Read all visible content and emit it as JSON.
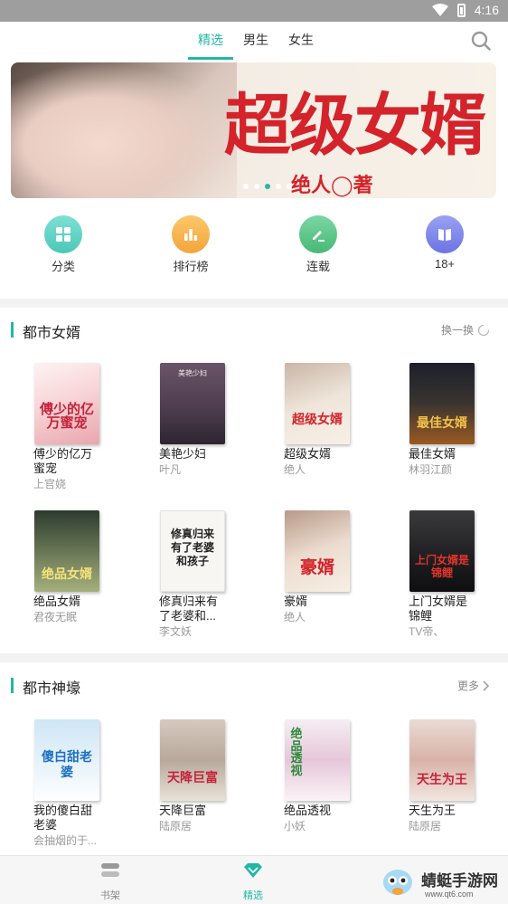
{
  "status_bar": {
    "time": "4:16"
  },
  "tabs": [
    {
      "label": "精选",
      "active": true
    },
    {
      "label": "男生",
      "active": false
    },
    {
      "label": "女生",
      "active": false
    }
  ],
  "banner": {
    "title": "超级女婿",
    "author": "绝人◯著",
    "dot_count": 5,
    "active_dot": 3
  },
  "shortcuts": [
    {
      "label": "分类",
      "icon": "grid-icon",
      "color": "#5fd3c6"
    },
    {
      "label": "排行榜",
      "icon": "bar-chart-icon",
      "color": "#f7b24b"
    },
    {
      "label": "连载",
      "icon": "pen-icon",
      "color": "#5cc58a"
    },
    {
      "label": "18+",
      "icon": "book-icon",
      "color": "#7d86ec"
    }
  ],
  "section1": {
    "title": "都市女婿",
    "action": "换一换",
    "books": [
      {
        "title": "傅少的亿万蜜宠",
        "author": "上官娆",
        "cover_text": "傅少的亿万蜜宠"
      },
      {
        "title": "美艳少妇",
        "author": "叶凡",
        "cover_text": "美艳少妇"
      },
      {
        "title": "超级女婿",
        "author": "绝人",
        "cover_text": "超级女婿"
      },
      {
        "title": "最佳女婿",
        "author": "林羽江颜",
        "cover_text": "最佳女婿"
      },
      {
        "title": "绝品女婿",
        "author": "君夜无眠",
        "cover_text": "绝品女婿"
      },
      {
        "title": "修真归来有了老婆和...",
        "author": "李文妖",
        "cover_text": "修真归来有了老婆和孩子"
      },
      {
        "title": "豪婿",
        "author": "绝人",
        "cover_text": "豪婿"
      },
      {
        "title": "上门女婿是锦鲤",
        "author": "TV帝、",
        "cover_text": "上门女婿是锦鲤"
      }
    ]
  },
  "section2": {
    "title": "都市神壕",
    "action": "更多",
    "books": [
      {
        "title": "我的傻白甜老婆",
        "author": "会抽烟的于...",
        "cover_text": "傻白甜老婆"
      },
      {
        "title": "天降巨富",
        "author": "陆原居",
        "cover_text": "天降巨富"
      },
      {
        "title": "绝品透视",
        "author": "小妖",
        "cover_text": "绝品透视"
      },
      {
        "title": "天生为王",
        "author": "陆原居",
        "cover_text": "天生为王"
      }
    ]
  },
  "bottom_nav": [
    {
      "label": "书架",
      "icon": "bookshelf-icon",
      "active": false
    },
    {
      "label": "精选",
      "icon": "diamond-icon",
      "active": true
    }
  ],
  "watermark": {
    "text": "蜻蜓手游网",
    "url": "www.qt6.com"
  },
  "colors": {
    "accent": "#23b7a5",
    "banner_red": "#d4232a"
  }
}
